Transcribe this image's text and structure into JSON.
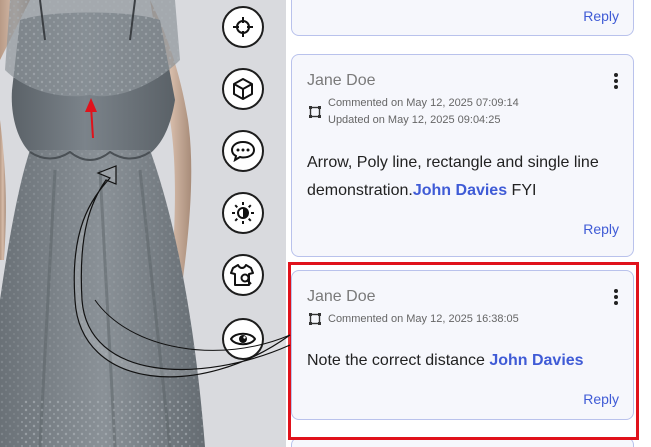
{
  "viewport": {
    "tools": [
      {
        "name": "crosshair-icon"
      },
      {
        "name": "cube-icon"
      },
      {
        "name": "chat-bubble-icon"
      },
      {
        "name": "brightness-icon"
      },
      {
        "name": "garment-search-icon"
      },
      {
        "name": "eye-icon"
      }
    ]
  },
  "comments": [
    {
      "reply_label": "Reply"
    },
    {
      "author": "Jane Doe",
      "commented": "Commented on May 12, 2025 07:09:14",
      "updated": "Updated on May 12, 2025 09:04:25",
      "text_before": "Arrow, Poly line, rectangle and single line demonstration.",
      "mention": "John Davies",
      "text_after": " FYI",
      "reply_label": "Reply"
    },
    {
      "author": "Jane Doe",
      "commented": "Commented on May 12, 2025 16:38:05",
      "text_before": "Note the correct distance ",
      "mention": "John Davies",
      "text_after": "",
      "reply_label": "Reply"
    }
  ],
  "colors": {
    "accent": "#3f5bd6",
    "selection": "#e0121b",
    "card_border": "#b9c2ec"
  }
}
